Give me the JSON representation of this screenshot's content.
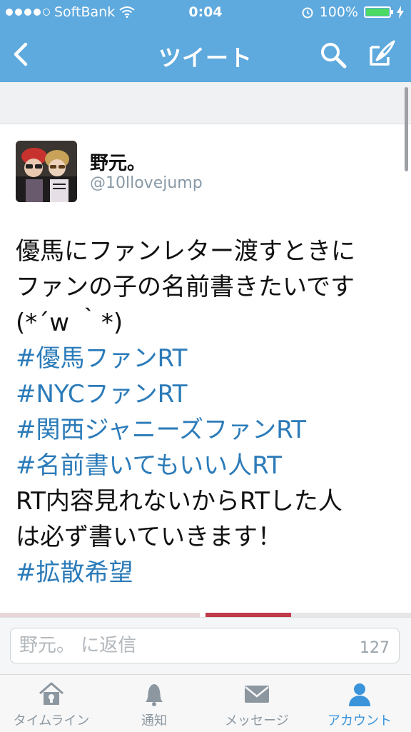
{
  "status_bar": {
    "carrier": "SoftBank",
    "time": "0:04",
    "battery_percent": "100%",
    "signal_bars": 4
  },
  "nav": {
    "title": "ツイート",
    "left_icon": "back-chevron-icon",
    "right_icons": [
      "search-icon",
      "compose-icon"
    ]
  },
  "tweet": {
    "author_name": "野元。",
    "author_handle": "@10llovejump",
    "lines": [
      {
        "text": "優馬にファンレター渡すときに",
        "hashtag": false
      },
      {
        "text": "ファンの子の名前書きたいです",
        "hashtag": false
      },
      {
        "text": "(*´w ｀*)",
        "hashtag": false
      },
      {
        "text": "#優馬ファンRT",
        "hashtag": true
      },
      {
        "text": "#NYCファンRT",
        "hashtag": true
      },
      {
        "text": "#関西ジャニーズファンRT",
        "hashtag": true
      },
      {
        "text": "#名前書いてもいい人RT",
        "hashtag": true
      },
      {
        "text": "RT内容見れないからRTした人",
        "hashtag": false
      },
      {
        "text": "は必ず書いていきます！",
        "hashtag": false
      },
      {
        "text": "#拡散希望",
        "hashtag": true
      }
    ]
  },
  "reply": {
    "placeholder": "野元。 に返信",
    "char_count": "127"
  },
  "tabs": [
    {
      "label": "タイムライン",
      "icon": "home-icon",
      "active": false
    },
    {
      "label": "通知",
      "icon": "bell-icon",
      "active": false
    },
    {
      "label": "メッセージ",
      "icon": "envelope-icon",
      "active": false
    },
    {
      "label": "アカウント",
      "icon": "person-icon",
      "active": true
    }
  ],
  "colors": {
    "brand": "#5ea9dd",
    "hashtag": "#2b7bb9",
    "battery": "#4cd964",
    "tab_active": "#3b94d9",
    "tab_inactive": "#8c97a0"
  }
}
